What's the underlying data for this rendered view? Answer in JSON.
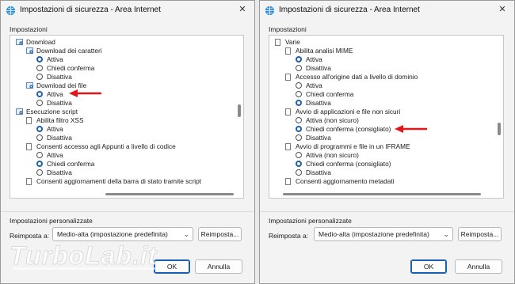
{
  "left": {
    "title": "Impostazioni di sicurezza - Area Internet",
    "close_glyph": "✕",
    "settings_label": "Impostazioni",
    "tree": [
      {
        "type": "category",
        "label": "Download",
        "level": 0
      },
      {
        "type": "category",
        "label": "Download dei caratteri",
        "level": 1
      },
      {
        "type": "radio",
        "label": "Attiva",
        "checked": true,
        "level": 2
      },
      {
        "type": "radio",
        "label": "Chiedi conferma",
        "checked": false,
        "level": 2
      },
      {
        "type": "radio",
        "label": "Disattiva",
        "checked": false,
        "level": 2
      },
      {
        "type": "category",
        "label": "Download dei file",
        "level": 1
      },
      {
        "type": "radio",
        "label": "Attiva",
        "checked": true,
        "level": 2
      },
      {
        "type": "radio",
        "label": "Disattiva",
        "checked": false,
        "level": 2
      },
      {
        "type": "category",
        "label": "Esecuzione script",
        "level": 0
      },
      {
        "type": "page",
        "label": "Abilita filtro XSS",
        "level": 1
      },
      {
        "type": "radio",
        "label": "Attiva",
        "checked": true,
        "level": 2
      },
      {
        "type": "radio",
        "label": "Disattiva",
        "checked": false,
        "level": 2
      },
      {
        "type": "page",
        "label": "Consenti accesso agli Appunti a livello di codice",
        "level": 1
      },
      {
        "type": "radio",
        "label": "Attiva",
        "checked": false,
        "level": 2
      },
      {
        "type": "radio",
        "label": "Chiedi conferma",
        "checked": true,
        "level": 2
      },
      {
        "type": "radio",
        "label": "Disattiva",
        "checked": false,
        "level": 2
      },
      {
        "type": "page",
        "label": "Consenti aggiornamenti della barra di stato tramite script",
        "level": 1
      }
    ],
    "custom_label": "Impostazioni personalizzate",
    "reset_label": "Reimposta a:",
    "reset_value": "Medio-alta (impostazione predefinita)",
    "reset_button": "Reimposta...",
    "ok_button": "OK",
    "cancel_button": "Annulla"
  },
  "right": {
    "title": "Impostazioni di sicurezza - Area Internet",
    "close_glyph": "✕",
    "settings_label": "Impostazioni",
    "tree": [
      {
        "type": "page",
        "label": "Varie",
        "level": 0
      },
      {
        "type": "page",
        "label": "Abilita analisi MIME",
        "level": 1
      },
      {
        "type": "radio",
        "label": "Attiva",
        "checked": true,
        "level": 2
      },
      {
        "type": "radio",
        "label": "Disattiva",
        "checked": false,
        "level": 2
      },
      {
        "type": "page",
        "label": "Accesso all'origine dati a livello di dominio",
        "level": 1
      },
      {
        "type": "radio",
        "label": "Attiva",
        "checked": false,
        "level": 2
      },
      {
        "type": "radio",
        "label": "Chiedi conferma",
        "checked": false,
        "level": 2
      },
      {
        "type": "radio",
        "label": "Disattiva",
        "checked": true,
        "level": 2
      },
      {
        "type": "page",
        "label": "Avvio di applicazioni e file non sicuri",
        "level": 1
      },
      {
        "type": "radio",
        "label": "Attiva (non sicuro)",
        "checked": false,
        "level": 2
      },
      {
        "type": "radio",
        "label": "Chiedi conferma (consigliato)",
        "checked": true,
        "level": 2
      },
      {
        "type": "radio",
        "label": "Disattiva",
        "checked": false,
        "level": 2
      },
      {
        "type": "page",
        "label": "Avvio di programmi e file in un IFRAME",
        "level": 1
      },
      {
        "type": "radio",
        "label": "Attiva (non sicuro)",
        "checked": false,
        "level": 2
      },
      {
        "type": "radio",
        "label": "Chiedi conferma (consigliato)",
        "checked": true,
        "level": 2
      },
      {
        "type": "radio",
        "label": "Disattiva",
        "checked": false,
        "level": 2
      },
      {
        "type": "page",
        "label": "Consenti aggiornamento metadati",
        "level": 1
      }
    ],
    "custom_label": "Impostazioni personalizzate",
    "reset_label": "Reimposta a:",
    "reset_value": "Medio-alta (impostazione predefinita)",
    "reset_button": "Reimposta...",
    "ok_button": "OK",
    "cancel_button": "Annulla"
  },
  "watermark": {
    "text": "TurboLab.it"
  },
  "colors": {
    "radio_accent": "#1f5fb0",
    "annotation_arrow": "#e0161b",
    "ok_border": "#1a5fb4"
  }
}
